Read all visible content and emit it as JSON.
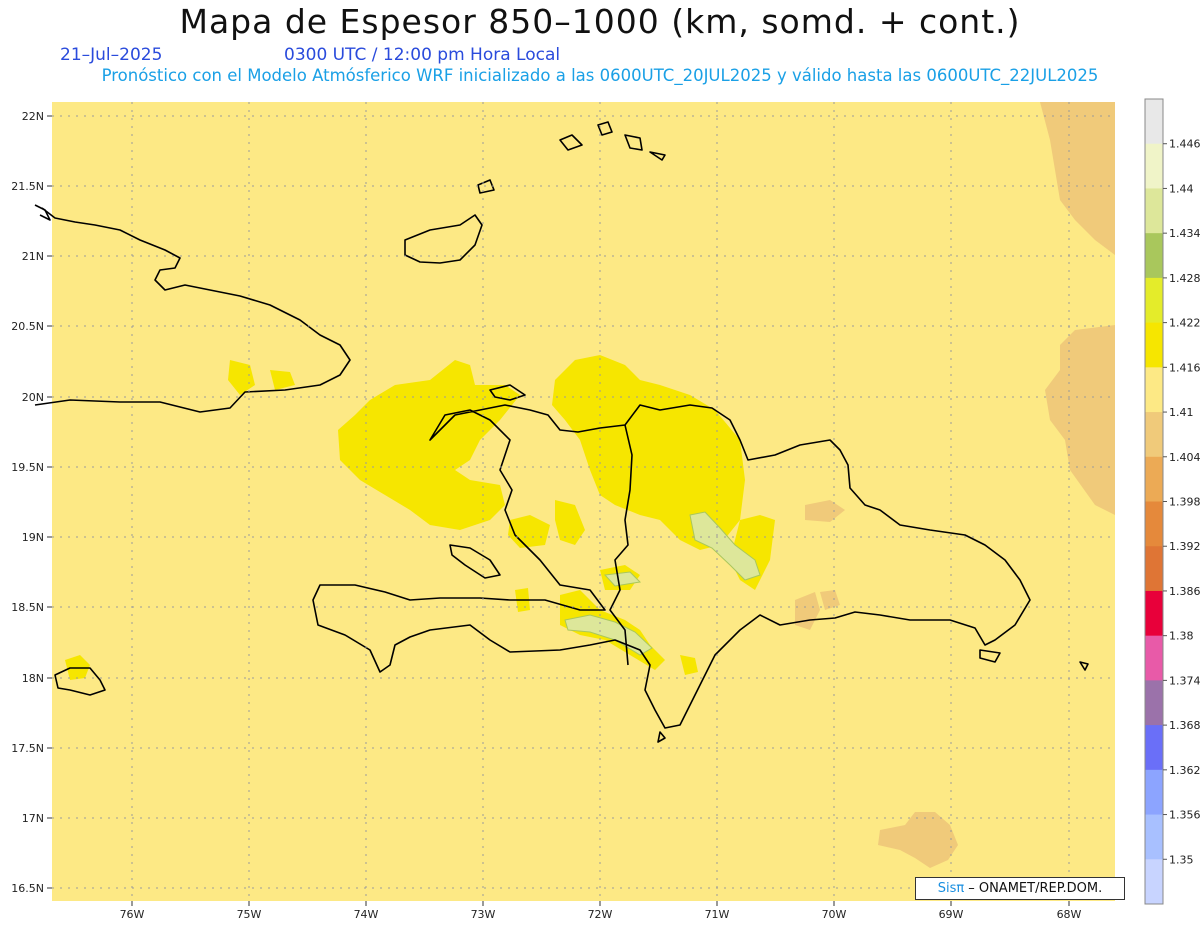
{
  "header": {
    "title": "Mapa de Espesor 850–1000 (km, somd. + cont.)",
    "date": "21–Jul–2025",
    "time": "0300 UTC / 12:00 pm Hora Local",
    "forecast_line": "Pronóstico con el Modelo Atmósferico WRF inicializado a las 0600UTC_20JUL2025 y válido hasta las  0600UTC_22JUL2025"
  },
  "axes": {
    "lat_labels": [
      "22N",
      "21.5N",
      "21N",
      "20.5N",
      "20N",
      "19.5N",
      "19N",
      "18.5N",
      "18N",
      "17.5N",
      "17N",
      "16.5N"
    ],
    "lon_labels": [
      "76W",
      "75W",
      "74W",
      "73W",
      "72W",
      "71W",
      "70W",
      "69W",
      "68W"
    ]
  },
  "colorbar": {
    "labels": [
      "1.446",
      "1.44",
      "1.434",
      "1.428",
      "1.422",
      "1.416",
      "1.41",
      "1.404",
      "1.398",
      "1.392",
      "1.386",
      "1.38",
      "1.374",
      "1.368",
      "1.362",
      "1.356",
      "1.35"
    ],
    "colors": [
      "#e8e8e8",
      "#f0f4c8",
      "#dde79a",
      "#a9c75c",
      "#e4ec2a",
      "#f6e600",
      "#fde985",
      "#f0ca7a",
      "#ecaa55",
      "#e5893b",
      "#df7535",
      "#e8003a",
      "#e85aa8",
      "#9b72aa",
      "#6a6ff8",
      "#8ca4ff",
      "#a8c0ff",
      "#c8d4ff"
    ]
  },
  "map": {
    "background_color": "#fde985"
  },
  "credit": {
    "sis": "Sisπ",
    "text": "– ONAMET/REP.DOM."
  }
}
